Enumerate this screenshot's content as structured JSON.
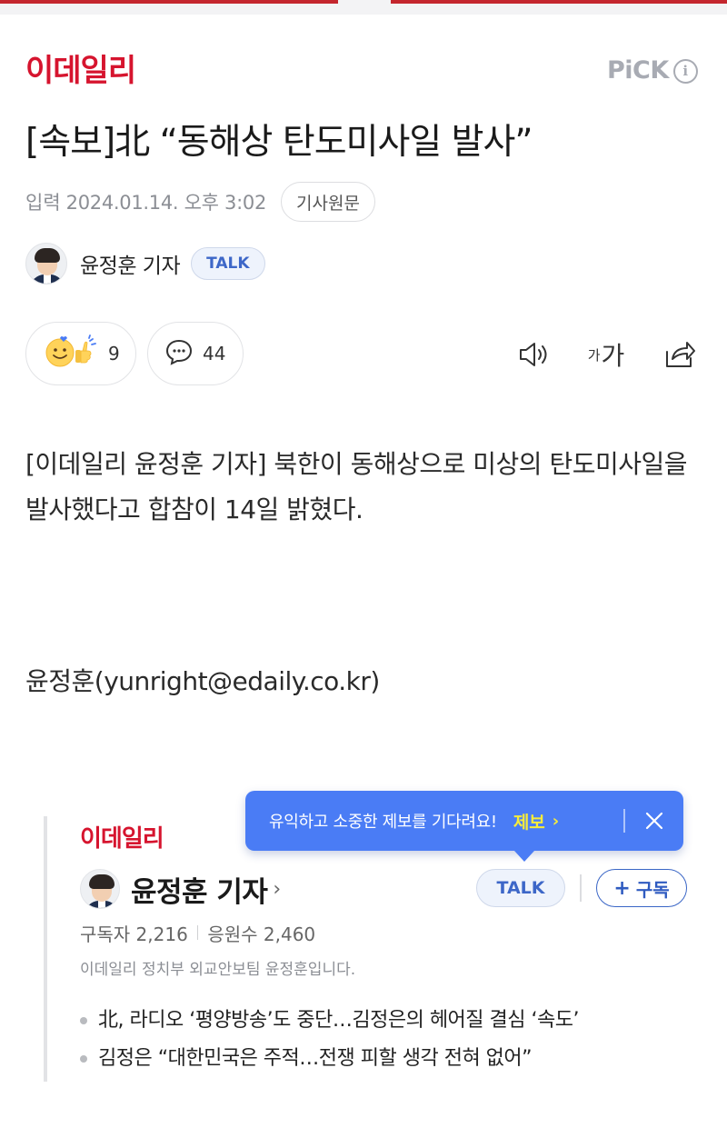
{
  "header": {
    "brand": "이데일리",
    "pick_label": "PiCK",
    "pick_info_icon": "i"
  },
  "article": {
    "headline": "[속보]北 “동해상 탄도미사일 발사”",
    "meta": {
      "label": "입력",
      "date": "2024.01.14. 오후 3:02",
      "original_button": "기사원문"
    },
    "author": {
      "name": "윤정훈 기자",
      "talk_label": "TALK"
    },
    "reactions": {
      "reaction_icon": "smile-thumbs-icon",
      "reaction_count": "9",
      "comment_icon": "speech-bubble-icon",
      "comment_count": "44"
    },
    "tools": {
      "speaker_icon": "speaker-icon",
      "font_small": "가",
      "font_big": "가",
      "share_icon": "share-icon"
    },
    "body": "[이데일리 윤정훈 기자] 북한이 동해상으로 미상의 탄도미사일을 발사했다고 합참이 14일 밝혔다.",
    "byline": "윤정훈(yunright@edaily.co.kr)"
  },
  "reporter_card": {
    "brand": "이데일리",
    "name": "윤정훈 기자",
    "chevron": "›",
    "talk_label": "TALK",
    "subscribe_plus": "+",
    "subscribe_label": "구독",
    "subscribers_label": "구독자 2,216",
    "supporters_label": "응원수 2,460",
    "description": "이데일리 정치부 외교안보팀 윤정훈입니다.",
    "news": [
      "北, 라디오 ‘평양방송’도 중단…김정은의 헤어질 결심 ‘속도’",
      "김정은 “대한민국은 주적…전쟁 피할 생각 전혀 없어”"
    ]
  },
  "tooltip": {
    "message": "유익하고 소중한 제보를 기다려요!",
    "action": "제보",
    "action_chevron": "›",
    "close_icon": "close-icon"
  },
  "colors": {
    "brand_red": "#d6142e",
    "talk_blue": "#3d67c8",
    "tooltip_bg": "#4a7cf5",
    "tooltip_action": "#f7ec3a"
  }
}
